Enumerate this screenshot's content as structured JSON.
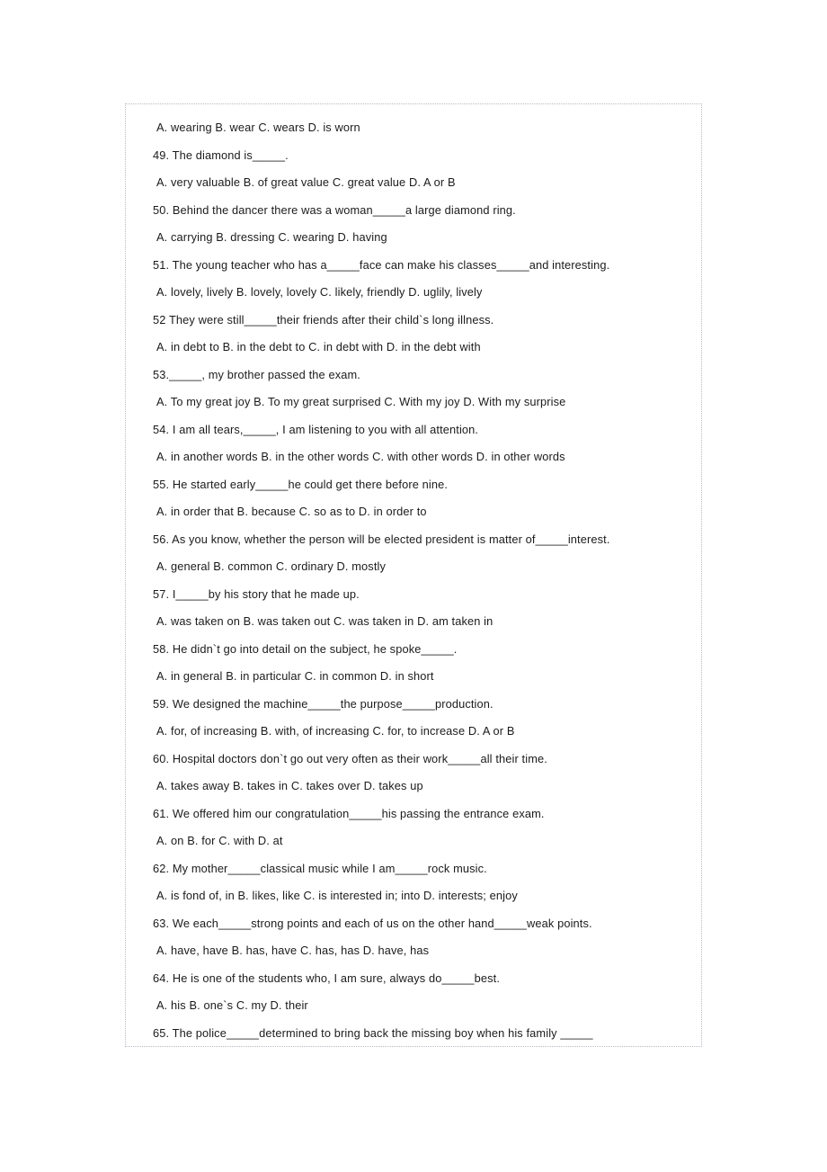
{
  "document": {
    "type": "multiple-choice-grammar-worksheet",
    "lines": [
      {
        "id": "opt-48",
        "kind": "options",
        "text": " A. wearing     B. wear     C. wears     D. is worn"
      },
      {
        "id": "q-49",
        "kind": "question",
        "text": "49. The diamond is_____."
      },
      {
        "id": "opt-49",
        "kind": "options",
        "text": " A. very valuable   B. of great value   C. great value   D. A or B"
      },
      {
        "id": "q-50",
        "kind": "question",
        "text": "50. Behind the dancer there was a woman_____a large diamond ring."
      },
      {
        "id": "opt-50",
        "kind": "options",
        "text": " A. carrying     B. dressing      C. wearing    D. having"
      },
      {
        "id": "q-51",
        "kind": "question",
        "text": "51. The young teacher who has a_____face can make his classes_____and interesting."
      },
      {
        "id": "opt-51",
        "kind": "options",
        "text": " A. lovely, lively    B. lovely, lovely    C. likely, friendly    D. uglily, lively"
      },
      {
        "id": "q-52",
        "kind": "question",
        "text": "52 They were still_____their friends after their child`s long illness."
      },
      {
        "id": "opt-52",
        "kind": "options",
        "text": " A. in debt to    B. in the debt to   C. in debt with    D. in the debt with"
      },
      {
        "id": "q-53",
        "kind": "question",
        "text": "53._____, my brother passed the exam."
      },
      {
        "id": "opt-53",
        "kind": "options",
        "text": " A. To my great joy   B. To my great surprised    C. With my joy    D. With my surprise"
      },
      {
        "id": "q-54",
        "kind": "question",
        "text": "54. I am all tears,_____, I am listening to you with all attention."
      },
      {
        "id": "opt-54",
        "kind": "options",
        "text": " A. in another words    B. in the other words    C. with other words  D. in other words"
      },
      {
        "id": "q-55",
        "kind": "question",
        "text": "55. He started early_____he could get there before nine."
      },
      {
        "id": "opt-55",
        "kind": "options",
        "text": " A. in order that    B. because     C. so as to   D. in order to"
      },
      {
        "id": "q-56",
        "kind": "question",
        "text": "56. As you know, whether the person will be elected president is matter of_____interest."
      },
      {
        "id": "opt-56",
        "kind": "options",
        "text": " A. general     B. common     C. ordinary     D. mostly"
      },
      {
        "id": "q-57",
        "kind": "question",
        "text": "57. I_____by his story that he made up."
      },
      {
        "id": "opt-57",
        "kind": "options",
        "text": " A. was taken on    B. was taken out    C. was taken in   D. am taken in"
      },
      {
        "id": "q-58",
        "kind": "question",
        "text": "58. He didn`t go into detail on the subject, he spoke_____."
      },
      {
        "id": "opt-58",
        "kind": "options",
        "text": " A. in general   B. in particular     C. in common   D. in short"
      },
      {
        "id": "q-59",
        "kind": "question",
        "text": "59. We designed the machine_____the purpose_____production."
      },
      {
        "id": "opt-59",
        "kind": "options",
        "text": " A. for, of increasing    B. with, of increasing   C. for, to increase   D. A or B"
      },
      {
        "id": "q-60",
        "kind": "question",
        "text": "60. Hospital doctors don`t go out very often as their work_____all their time."
      },
      {
        "id": "opt-60",
        "kind": "options",
        "text": " A. takes away   B. takes in    C. takes over   D. takes up"
      },
      {
        "id": "q-61",
        "kind": "question",
        "text": "61. We offered him our congratulation_____his passing the entrance exam."
      },
      {
        "id": "opt-61",
        "kind": "options",
        "text": " A. on     B. for     C. with     D. at"
      },
      {
        "id": "q-62",
        "kind": "question",
        "text": "62. My mother_____classical music while I am_____rock music."
      },
      {
        "id": "opt-62",
        "kind": "options",
        "text": " A. is fond of, in    B. likes, like    C. is interested in; into    D. interests; enjoy"
      },
      {
        "id": "q-63",
        "kind": "question",
        "text": "63. We each_____strong points and each of us on the other hand_____weak points."
      },
      {
        "id": "opt-63",
        "kind": "options",
        "text": " A. have, have   B. has, have   C. has, has   D. have, has"
      },
      {
        "id": "q-64",
        "kind": "question",
        "text": "64. He is one of the students who, I am sure, always do_____best."
      },
      {
        "id": "opt-64",
        "kind": "options",
        "text": " A. his      B. one`s      C. my      D. their"
      },
      {
        "id": "q-65",
        "kind": "question",
        "text": "65. The police_____determined to bring back the missing boy when his family _____"
      }
    ]
  }
}
